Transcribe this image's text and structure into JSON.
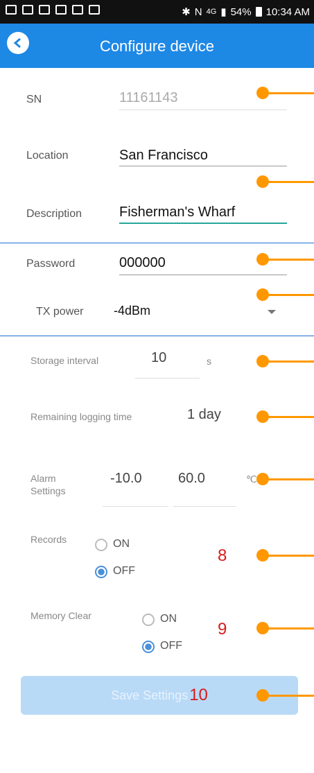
{
  "status_bar": {
    "battery": "54%",
    "time": "10:34 AM",
    "network": "4G"
  },
  "appbar": {
    "title": "Configure device",
    "back_icon": "back-arrow-icon"
  },
  "form": {
    "sn": {
      "label": "SN",
      "value": "11161143"
    },
    "location": {
      "label": "Location",
      "value": "San Francisco"
    },
    "description": {
      "label": "Description",
      "value": "Fisherman's Wharf"
    },
    "password": {
      "label": "Password",
      "value": "000000"
    },
    "tx_power": {
      "label": "TX power",
      "value": "-4dBm"
    },
    "storage_interval": {
      "label": "Storage interval",
      "value": "10",
      "unit": "s"
    },
    "remaining_logging": {
      "label": "Remaining logging time",
      "value": "1 day"
    },
    "alarm": {
      "label_line1": "Alarm",
      "label_line2": "Settings",
      "low": "-10.0",
      "high": "60.0",
      "unit": "℃"
    },
    "records": {
      "label": "Records",
      "on": "ON",
      "off": "OFF",
      "selected": "OFF",
      "marker": "8"
    },
    "memory_clear": {
      "label": "Memory Clear",
      "on": "ON",
      "off": "OFF",
      "selected": "OFF",
      "marker": "9"
    }
  },
  "save": {
    "label": "Save Settings",
    "marker": "10"
  },
  "colors": {
    "accent": "#1e88e5",
    "marker": "#ff9800",
    "red": "#d81b1b"
  }
}
